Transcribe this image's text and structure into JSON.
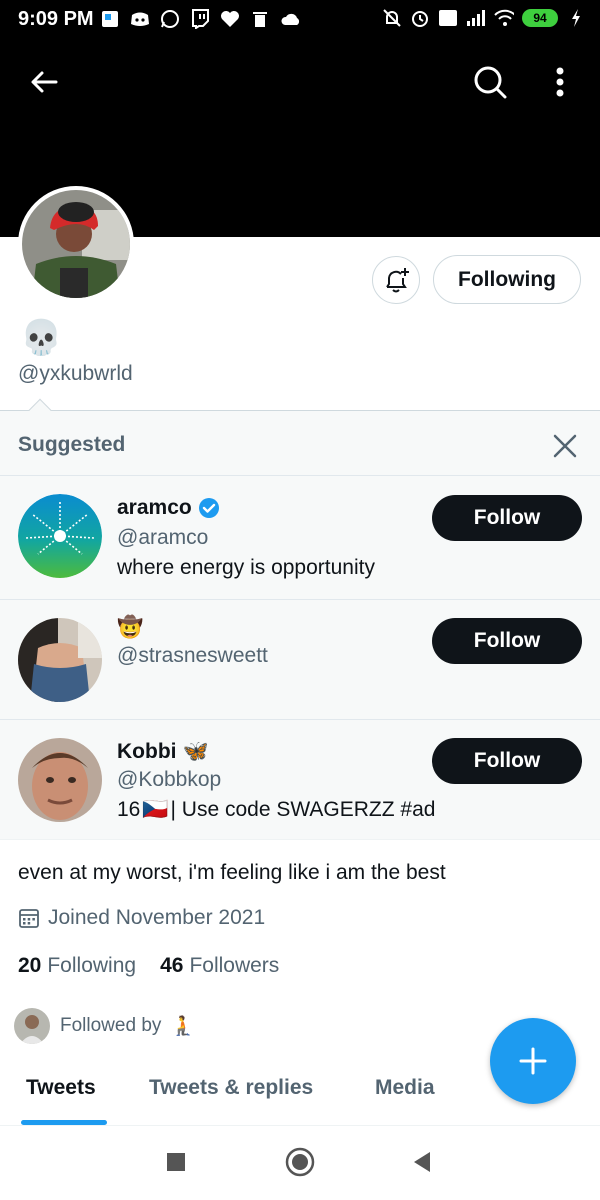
{
  "status_bar": {
    "time": "9:09 PM",
    "battery": "94"
  },
  "profile": {
    "display_name": "💀",
    "handle": "@yxkubwrld",
    "following_button": "Following",
    "bio": "even at my worst, i'm feeling like i am the best",
    "joined": "Joined November 2021",
    "following_count": "20",
    "following_label": "Following",
    "followers_count": "46",
    "followers_label": "Followers",
    "followed_by_label": "Followed by",
    "followed_by_emoji": "🧎"
  },
  "suggested": {
    "title": "Suggested",
    "follow_label": "Follow",
    "accounts": [
      {
        "name": "aramco",
        "verified": true,
        "handle": "@aramco",
        "bio": "where energy is opportunity"
      },
      {
        "name": "🤠",
        "handle": "@strasnesweett"
      },
      {
        "name": "Kobbi",
        "name_emoji": "🦋",
        "handle": "@Kobbkop",
        "bio_prefix": "16",
        "bio_flag": "🇨🇿",
        "bio": " | Use code SWAGERZZ #ad"
      }
    ]
  },
  "tabs": [
    {
      "label": "Tweets",
      "active": true
    },
    {
      "label": "Tweets & replies"
    },
    {
      "label": "Media"
    }
  ],
  "colors": {
    "accent": "#1d9bf0",
    "text": "#0f1419",
    "secondary": "#536471"
  }
}
